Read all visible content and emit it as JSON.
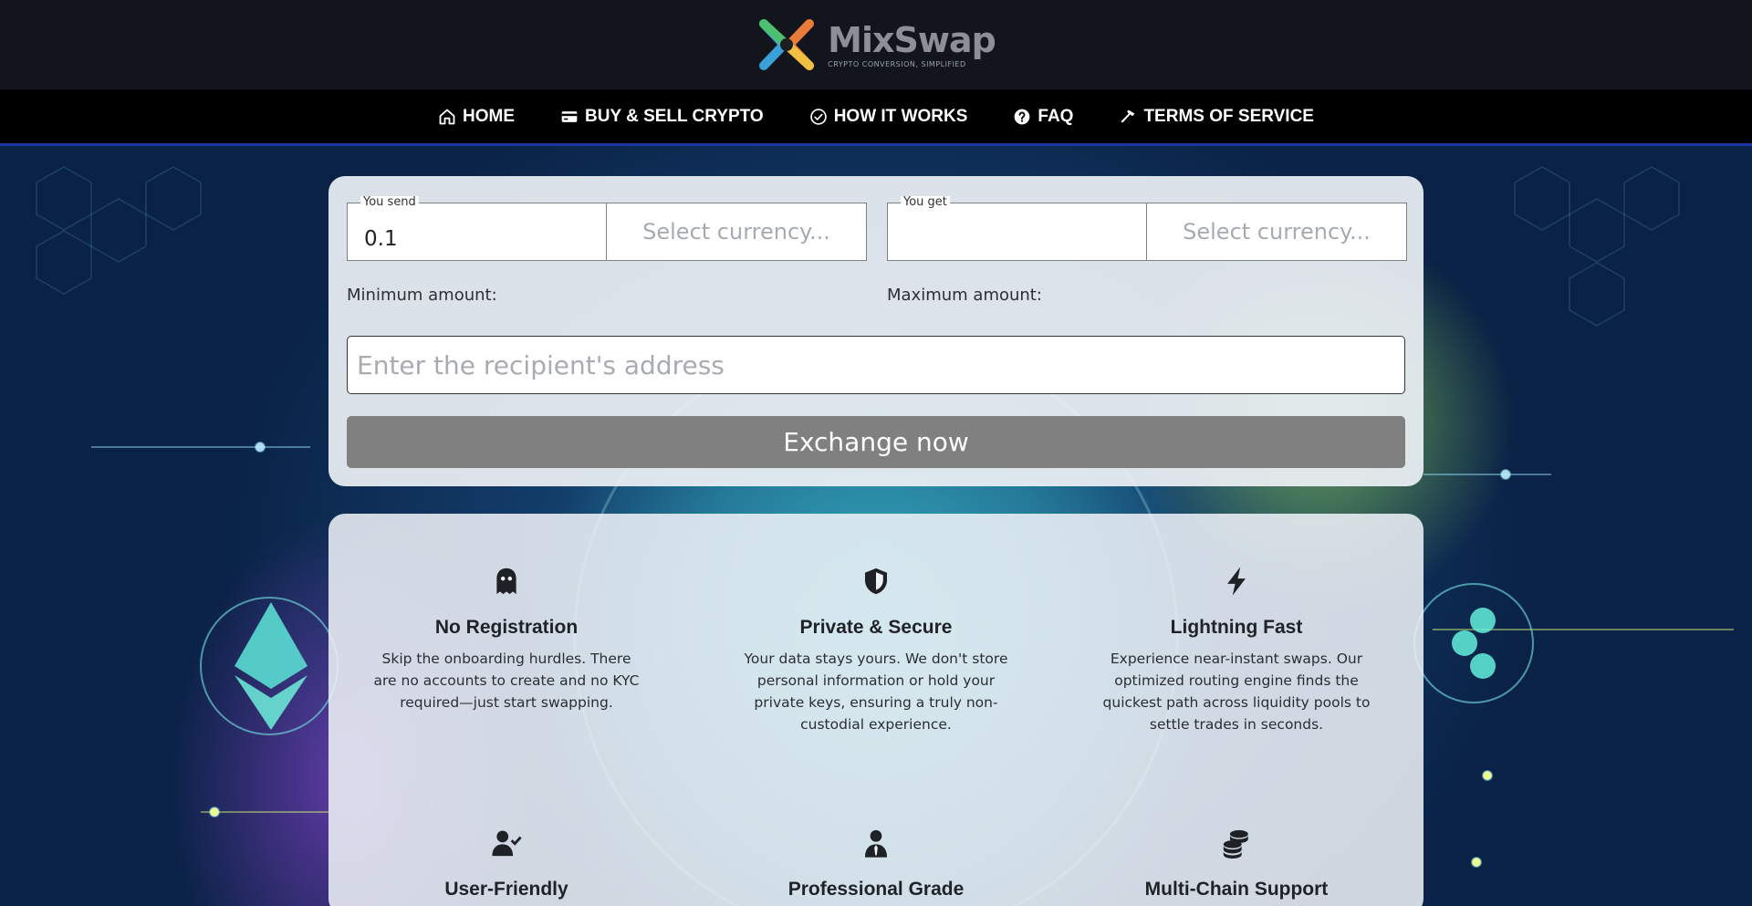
{
  "header": {
    "brand_name": "MixSwap",
    "brand_tagline": "CRYPTO CONVERSION, SIMPLIFIED"
  },
  "nav": {
    "items": [
      {
        "label": "HOME",
        "icon": "home-icon"
      },
      {
        "label": "BUY & SELL CRYPTO",
        "icon": "card-icon"
      },
      {
        "label": "HOW IT WORKS",
        "icon": "check-circle-icon"
      },
      {
        "label": "FAQ",
        "icon": "question-circle-icon"
      },
      {
        "label": "TERMS OF SERVICE",
        "icon": "hammer-icon"
      }
    ]
  },
  "exchange": {
    "send_label": "You send",
    "send_value": "0.1",
    "send_currency_placeholder": "Select currency...",
    "get_label": "You get",
    "get_value": "",
    "get_currency_placeholder": "Select currency...",
    "min_label": "Minimum amount:",
    "max_label": "Maximum amount:",
    "address_placeholder": "Enter the recipient's address",
    "button_label": "Exchange now"
  },
  "features": [
    {
      "icon": "ghost-icon",
      "title": "No Registration",
      "desc": "Skip the onboarding hurdles. There are no accounts to create and no KYC required—just start swapping."
    },
    {
      "icon": "shield-icon",
      "title": "Private & Secure",
      "desc": "Your data stays yours. We don't store personal information or hold your private keys, ensuring a truly non-custodial experience."
    },
    {
      "icon": "bolt-icon",
      "title": "Lightning Fast",
      "desc": "Experience near-instant swaps. Our optimized routing engine finds the quickest path across liquidity pools to settle trades in seconds."
    },
    {
      "icon": "user-check-icon",
      "title": "User-Friendly",
      "desc": ""
    },
    {
      "icon": "user-tie-icon",
      "title": "Professional Grade",
      "desc": ""
    },
    {
      "icon": "coins-icon",
      "title": "Multi-Chain Support",
      "desc": ""
    }
  ],
  "colors": {
    "nav_bg": "#000000",
    "nav_border": "#1b35a6",
    "header_bg": "#12161c",
    "button_bg": "#808080"
  }
}
